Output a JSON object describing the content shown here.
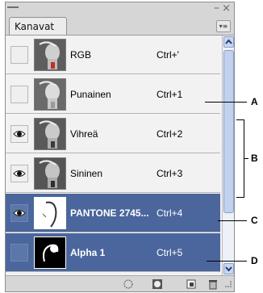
{
  "panel": {
    "tab_label": "Kanavat",
    "tab_close": "×",
    "minimize_glyph": "–",
    "close_glyph": "×",
    "menu_glyph": "▾≡"
  },
  "channels": [
    {
      "name": "RGB",
      "shortcut": "Ctrl+'",
      "visible": false,
      "selected": false
    },
    {
      "name": "Punainen",
      "shortcut": "Ctrl+1",
      "visible": false,
      "selected": false
    },
    {
      "name": "Vihreä",
      "shortcut": "Ctrl+2",
      "visible": true,
      "selected": false
    },
    {
      "name": "Sininen",
      "shortcut": "Ctrl+3",
      "visible": true,
      "selected": false
    },
    {
      "name": "PANTONE 2745...",
      "shortcut": "Ctrl+4",
      "visible": true,
      "selected": true
    },
    {
      "name": "Alpha 1",
      "shortcut": "Ctrl+5",
      "visible": false,
      "selected": true
    }
  ],
  "callouts": {
    "a": "A",
    "b": "B",
    "c": "C",
    "d": "D"
  },
  "colors": {
    "selection": "#4a669c",
    "row": "#f2f2f2"
  },
  "footer_icons": [
    "load-selection-icon",
    "save-selection-icon",
    "new-channel-icon",
    "trash-icon"
  ]
}
